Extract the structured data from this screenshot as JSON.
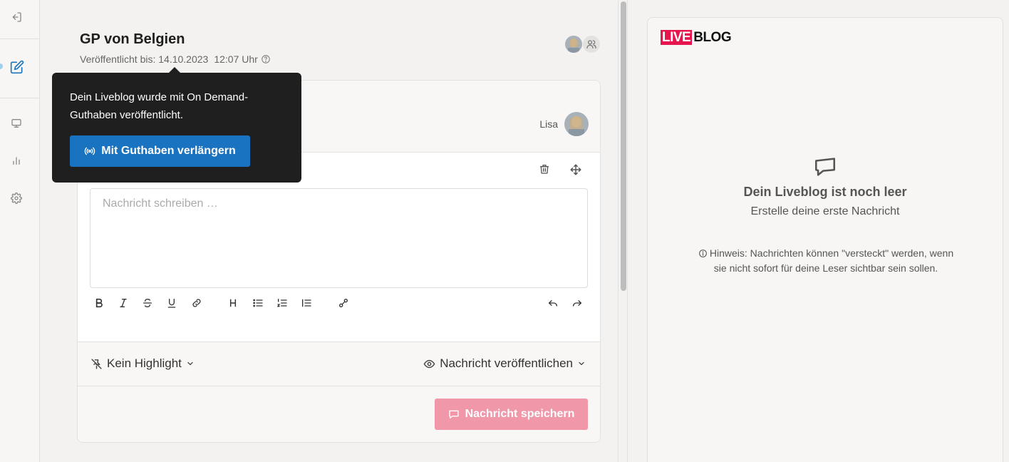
{
  "header": {
    "title": "GP von Belgien",
    "published_label": "Veröffentlicht bis: 14.10.2023",
    "published_time": "12:07 Uhr"
  },
  "tooltip": {
    "text": "Dein Liveblog wurde mit On Demand-Guthaben veröffentlicht.",
    "button_label": "Mit Guthaben verlängern"
  },
  "editor": {
    "author": "Lisa",
    "placeholder": "Nachricht schreiben …",
    "highlight_label": "Kein Highlight",
    "publish_label": "Nachricht veröffentlichen",
    "save_label": "Nachricht speichern"
  },
  "preview": {
    "logo_live": "LIVE",
    "logo_blog": "BLOG",
    "empty_title": "Dein Liveblog ist noch leer",
    "empty_subtitle": "Erstelle deine erste Nachricht",
    "hint": "Hinweis: Nachrichten können \"versteckt\" werden, wenn sie nicht sofort für deine Leser sichtbar sein sollen."
  },
  "colors": {
    "accent_blue": "#1a73c0",
    "save_pink": "#f097a9",
    "logo_red": "#e6154d",
    "tooltip_bg": "#1f1f1f"
  }
}
